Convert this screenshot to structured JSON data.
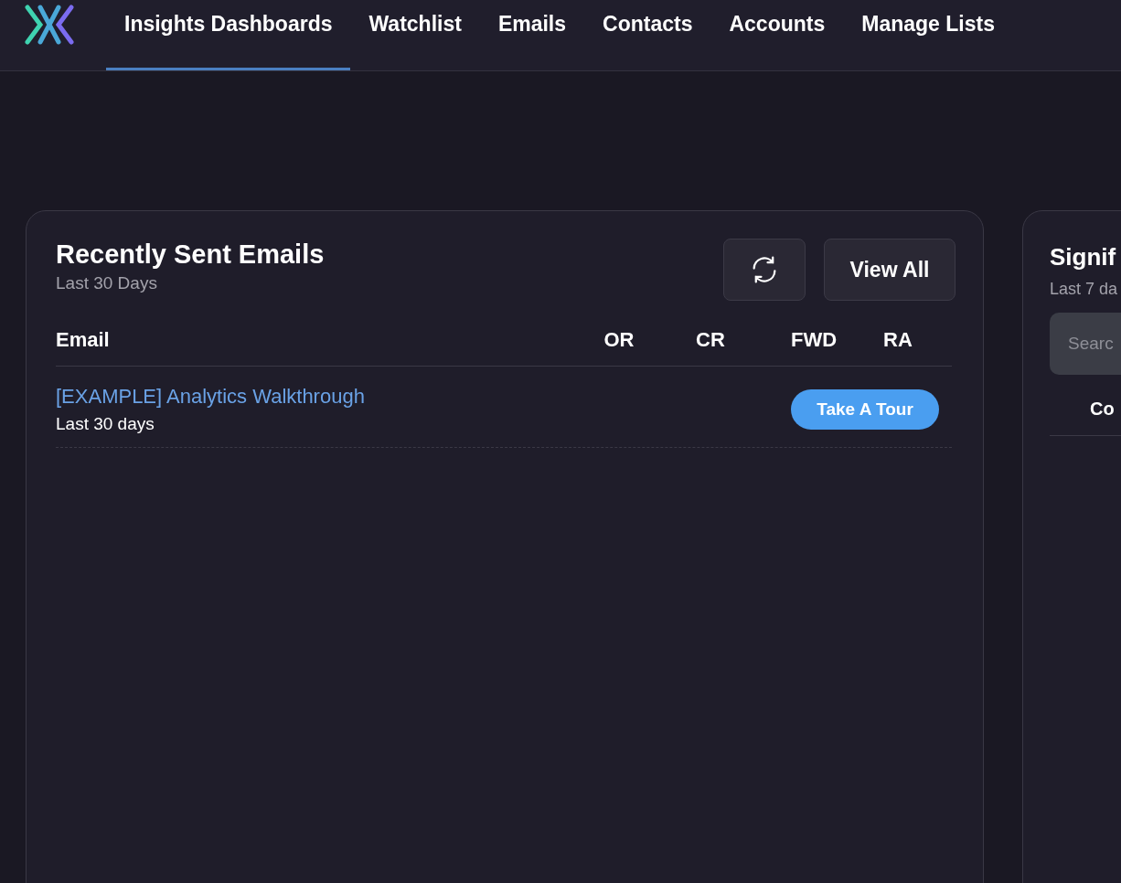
{
  "nav": {
    "tabs": [
      {
        "label": "Insights Dashboards",
        "selected": true
      },
      {
        "label": "Watchlist",
        "selected": false
      },
      {
        "label": "Emails",
        "selected": false
      },
      {
        "label": "Contacts",
        "selected": false
      },
      {
        "label": "Accounts",
        "selected": false
      },
      {
        "label": "Manage Lists",
        "selected": false
      }
    ]
  },
  "emails_card": {
    "title": "Recently Sent Emails",
    "subtitle": "Last 30 Days",
    "view_all": "View All",
    "columns": [
      "Email",
      "OR",
      "CR",
      "FWD",
      "RA"
    ],
    "rows": [
      {
        "name": "[EXAMPLE] Analytics Walkthrough",
        "period": "Last 30 days",
        "action": "Take A Tour"
      }
    ]
  },
  "side_card": {
    "title": "Signif",
    "subtitle": "Last 7 da",
    "search_placeholder": "Searc",
    "column_1": "Co"
  }
}
